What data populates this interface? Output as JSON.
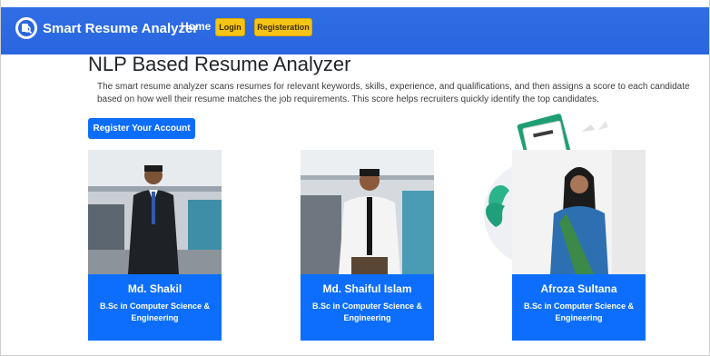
{
  "navbar": {
    "brand": "Smart Resume Analyzer",
    "home": "Home",
    "login": "Login",
    "register": "Registeration"
  },
  "hero": {
    "title": "NLP Based Resume Analyzer",
    "description": "The smart resume analyzer scans resumes for relevant keywords, skills, experience, and qualifications, and then assigns a score to each candidate based on how well their resume matches the job requirements. This score helps recruiters quickly identify the top candidates.",
    "cta": "Register Your Account"
  },
  "team": [
    {
      "name": "Md. Shakil",
      "degree": "B.Sc in Computer Science & Engineering"
    },
    {
      "name": "Md. Shaiful Islam",
      "degree": "B.Sc in Computer Science & Engineering"
    },
    {
      "name": "Afroza Sultana",
      "degree": "B.Sc in Computer Science & Engineering"
    }
  ],
  "colors": {
    "navbar": "#2a66df",
    "accent": "#0d6efd",
    "nav_button": "#f6c415"
  },
  "icons": {
    "brand": "magnifier-document-icon"
  }
}
